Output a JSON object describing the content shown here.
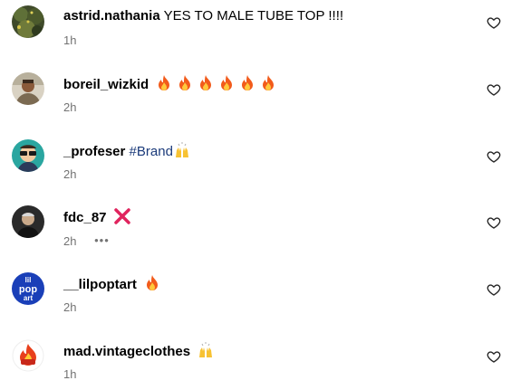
{
  "comments": [
    {
      "username": "astrid.nathania",
      "text": "YES TO MALE TUBE TOP !!!!",
      "time": "1h",
      "avatar_icon": "avatar-greenery-icon"
    },
    {
      "username": "boreil_wizkid",
      "emojis": [
        "fire",
        "fire",
        "fire",
        "fire",
        "fire",
        "fire"
      ],
      "time": "2h",
      "avatar_icon": "avatar-person-icon"
    },
    {
      "username": "_profeser",
      "hashtag": "#Brand",
      "emojis": [
        "raising-hands"
      ],
      "time": "2h",
      "avatar_icon": "avatar-cartoon-icon"
    },
    {
      "username": "fdc_87",
      "emojis": [
        "cross-mark"
      ],
      "time": "2h",
      "more_label": "•••",
      "avatar_icon": "avatar-person-dark-icon"
    },
    {
      "username": "__lilpoptart",
      "emojis": [
        "fire"
      ],
      "time": "2h",
      "avatar_icon": "avatar-lil-pop-art-logo-icon",
      "avatar_text": [
        "lil",
        "pop",
        "art"
      ]
    },
    {
      "username": "mad.vintageclothes",
      "emojis": [
        "raising-hands"
      ],
      "time": "1h",
      "avatar_icon": "avatar-flame-logo-icon"
    }
  ],
  "colors": {
    "username": "#000000",
    "meta": "#737373",
    "hashtag": "#1a3a7a",
    "fire": "#f25b1b",
    "cross": "#e0245e",
    "hands": "#f7c233"
  }
}
